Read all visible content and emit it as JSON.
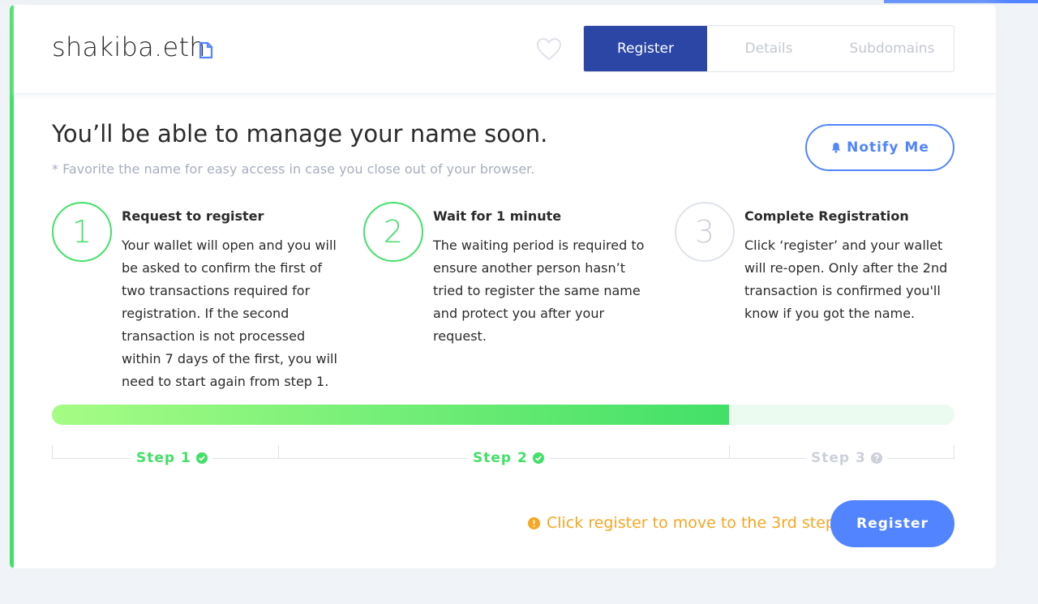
{
  "header": {
    "domain_name": "shakiba.eth",
    "tabs": [
      {
        "label": "Register",
        "active": true
      },
      {
        "label": "Details",
        "active": false
      },
      {
        "label": "Subdomains",
        "active": false
      }
    ]
  },
  "intro": {
    "title": "You’ll be able to manage your name soon.",
    "note": "* Favorite the name for easy access in case you close out of your browser.",
    "notify_label": "Notify Me"
  },
  "steps": [
    {
      "number": "1",
      "title": "Request to register",
      "text": "Your wallet will open and you will be asked to confirm the first of two transactions required for registration. If the second transaction is not processed within 7 days of the first, you will need to start again from step 1.",
      "state": "done"
    },
    {
      "number": "2",
      "title": "Wait for 1 minute",
      "text": "The waiting period is required to ensure another person hasn’t tried to register the same name and protect you after your request.",
      "state": "done"
    },
    {
      "number": "3",
      "title": "Complete Registration",
      "text": "Click ‘register’ and your wallet will re-open. Only after the 2nd transaction is confirmed you'll know if you got the name.",
      "state": "pending"
    }
  ],
  "progress": {
    "fraction": 0.75
  },
  "timeline": {
    "labels": [
      "Step 1",
      "Step 2",
      "Step 3"
    ]
  },
  "footer": {
    "warning": "Click register to move to the 3rd step",
    "register_label": "Register"
  },
  "colors": {
    "accent": "#5284ff",
    "active_tab": "#2c46a6",
    "success": "#42e068",
    "warning": "#f5a623",
    "muted": "#ccd1d9"
  },
  "icons": {
    "domain": "document-icon",
    "favorite": "heart-icon",
    "notify": "bell-icon",
    "done": "check-circle-icon",
    "pending": "question-circle-icon",
    "warning": "exclamation-circle-icon"
  }
}
